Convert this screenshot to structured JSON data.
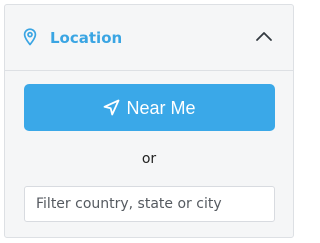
{
  "location_panel": {
    "title": "Location",
    "expanded": true,
    "icons": {
      "title_icon": "map-pin-icon",
      "toggle_icon": "chevron-up-icon",
      "button_icon": "navigation-arrow-icon"
    },
    "near_me_button": {
      "label": "Near Me"
    },
    "separator_text": "or",
    "filter_input": {
      "value": "",
      "placeholder": "Filter country, state or city"
    },
    "colors": {
      "accent": "#3aa5e3",
      "button_background": "#3aa8e8",
      "panel_background": "#f5f6f7"
    }
  }
}
